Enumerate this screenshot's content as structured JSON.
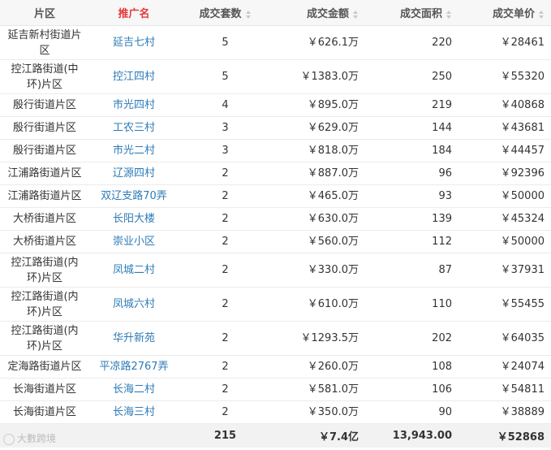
{
  "headers": {
    "area": "片区",
    "project": "推广名",
    "count": "成交套数",
    "amount": "成交金额",
    "size": "成交面积",
    "price": "成交单价"
  },
  "rows": [
    {
      "area": "延吉新村街道片区",
      "project": "延吉七村",
      "count": "5",
      "amount": "￥626.1万",
      "size": "220",
      "price": "￥28461",
      "type": "r1"
    },
    {
      "area": "控江路街道(中环)片区",
      "project": "控江四村",
      "count": "5",
      "amount": "￥1383.0万",
      "size": "250",
      "price": "￥55320",
      "type": "r2"
    },
    {
      "area": "殷行街道片区",
      "project": "市光四村",
      "count": "4",
      "amount": "￥895.0万",
      "size": "219",
      "price": "￥40868",
      "type": "s"
    },
    {
      "area": "殷行街道片区",
      "project": "工农三村",
      "count": "3",
      "amount": "￥629.0万",
      "size": "144",
      "price": "￥43681",
      "type": "s"
    },
    {
      "area": "殷行街道片区",
      "project": "市光二村",
      "count": "3",
      "amount": "￥818.0万",
      "size": "184",
      "price": "￥44457",
      "type": "s"
    },
    {
      "area": "江浦路街道片区",
      "project": "辽源四村",
      "count": "2",
      "amount": "￥887.0万",
      "size": "96",
      "price": "￥92396",
      "type": "s"
    },
    {
      "area": "江浦路街道片区",
      "project": "双辽支路70弄",
      "count": "2",
      "amount": "￥465.0万",
      "size": "93",
      "price": "￥50000",
      "type": "s"
    },
    {
      "area": "大桥街道片区",
      "project": "长阳大楼",
      "count": "2",
      "amount": "￥630.0万",
      "size": "139",
      "price": "￥45324",
      "type": "s"
    },
    {
      "area": "大桥街道片区",
      "project": "崇业小区",
      "count": "2",
      "amount": "￥560.0万",
      "size": "112",
      "price": "￥50000",
      "type": "s"
    },
    {
      "area": "控江路街道(内环)片区",
      "project": "凤城二村",
      "count": "2",
      "amount": "￥330.0万",
      "size": "87",
      "price": "￥37931",
      "type": "r2"
    },
    {
      "area": "控江路街道(内环)片区",
      "project": "凤城六村",
      "count": "2",
      "amount": "￥610.0万",
      "size": "110",
      "price": "￥55455",
      "type": "r2"
    },
    {
      "area": "控江路街道(内环)片区",
      "project": "华升新苑",
      "count": "2",
      "amount": "￥1293.5万",
      "size": "202",
      "price": "￥64035",
      "type": "r2"
    },
    {
      "area": "定海路街道片区",
      "project": "平凉路2767弄",
      "count": "2",
      "amount": "￥260.0万",
      "size": "108",
      "price": "￥24074",
      "type": "s"
    },
    {
      "area": "长海街道片区",
      "project": "长海二村",
      "count": "2",
      "amount": "￥581.0万",
      "size": "106",
      "price": "￥54811",
      "type": "s"
    },
    {
      "area": "长海街道片区",
      "project": "长海三村",
      "count": "2",
      "amount": "￥350.0万",
      "size": "90",
      "price": "￥38889",
      "type": "s"
    }
  ],
  "totals": {
    "count": "215",
    "amount": "￥7.4亿",
    "size": "13,943.00",
    "price": "￥52868"
  },
  "watermark": "大數跨境",
  "colors": {
    "header_bg": "#f7f7f7",
    "link": "#2e7bb7",
    "accent_red": "#e4393c",
    "footer_bg": "#f2f2f2"
  }
}
